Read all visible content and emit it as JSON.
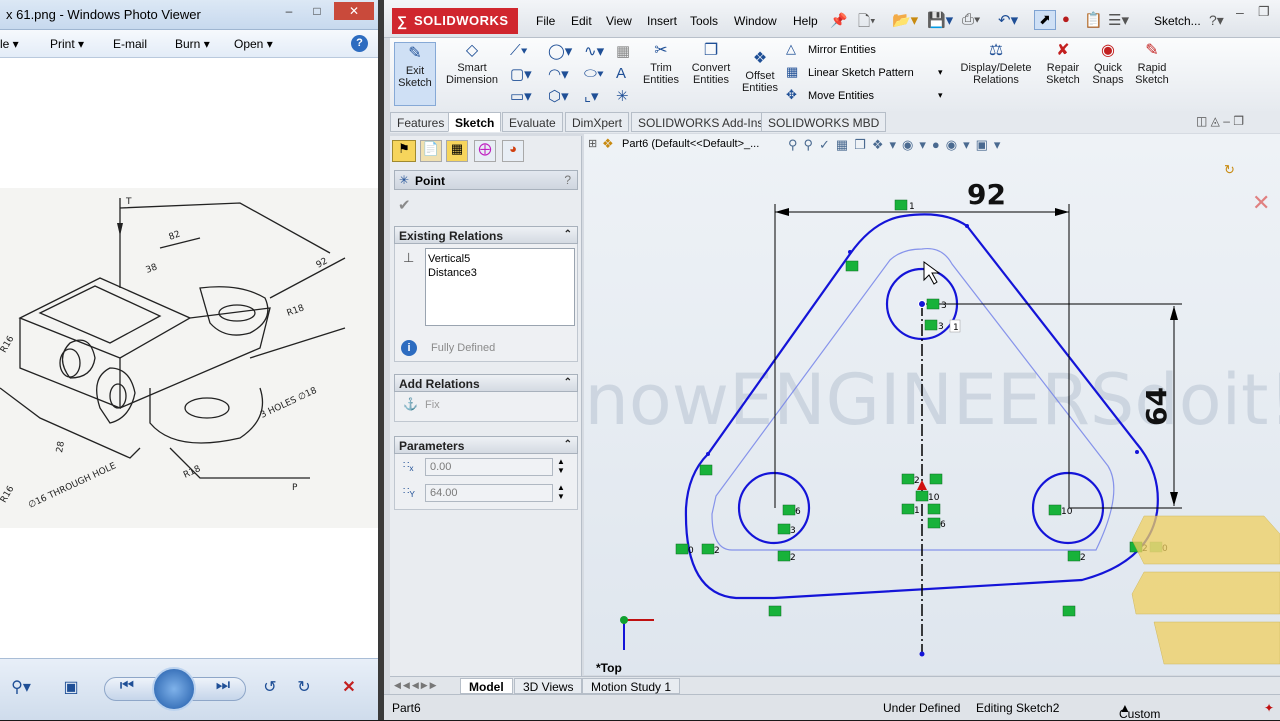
{
  "photo_viewer": {
    "title": "x 61.png - Windows Photo Viewer",
    "menu": [
      "le",
      "Print",
      "E-mail",
      "Burn",
      "Open"
    ],
    "drawing_labels": {
      "top_label": "T",
      "dim_82": "82",
      "dim_92": "92",
      "dim_38": "38",
      "r18": "R18",
      "r16": "R16",
      "holes_note": "3 HOLES ∅18",
      "through_hole": "∅16 THROUGH HOLE",
      "dim_28": "28",
      "p_label": "P",
      "r18b": "R18",
      "r16b": "R16"
    }
  },
  "solidworks": {
    "logo": "SOLIDWORKS",
    "menu": [
      "File",
      "Edit",
      "View",
      "Insert",
      "Tools",
      "Window",
      "Help"
    ],
    "sketch_dropdown": "Sketch...",
    "commands": {
      "exit_sketch": "Exit\nSketch",
      "smart_dimension": "Smart\nDimension",
      "trim": "Trim\nEntities",
      "convert": "Convert\nEntities",
      "offset": "Offset\nEntities",
      "mirror": "Mirror Entities",
      "linear_pattern": "Linear Sketch Pattern",
      "move": "Move Entities",
      "display_delete": "Display/Delete\nRelations",
      "repair": "Repair\nSketch",
      "quick_snaps": "Quick\nSnaps",
      "rapid": "Rapid\nSketch"
    },
    "tabs": [
      "Features",
      "Sketch",
      "Evaluate",
      "DimXpert",
      "SOLIDWORKS Add-Ins",
      "SOLIDWORKS MBD"
    ],
    "active_tab": "Sketch",
    "property_manager": {
      "title": "Point",
      "help": "?",
      "existing_relations_header": "Existing Relations",
      "relations": [
        "Vertical5",
        "Distance3"
      ],
      "status": "Fully Defined",
      "add_relations_header": "Add Relations",
      "fix": "Fix",
      "parameters_header": "Parameters",
      "x_value": "0.00",
      "y_value": "64.00",
      "x_label": "x",
      "y_label": "Y"
    },
    "graphics": {
      "breadcrumb": "Part6  (Default<<Default>_...",
      "dim_width": "92",
      "dim_height": "64",
      "view_label": "*Top",
      "watermark": "knowENGINEERSdoit!",
      "relation_labels": [
        "1",
        "3",
        "3",
        "1",
        "6",
        "3",
        "2",
        "2",
        "10",
        "1",
        "5",
        "6",
        "10",
        "2",
        "0",
        "2",
        "2",
        "0",
        "1"
      ]
    },
    "bottom_tabs": [
      "Model",
      "3D Views",
      "Motion Study 1"
    ],
    "active_bottom_tab": "Model",
    "status": {
      "part": "Part6",
      "definition": "Under Defined",
      "mode": "Editing Sketch2",
      "units": "Custom"
    },
    "colors": {
      "sketch_blue": "#1414d8",
      "relation_green": "#18b23a",
      "brand_red": "#d0262e"
    }
  }
}
